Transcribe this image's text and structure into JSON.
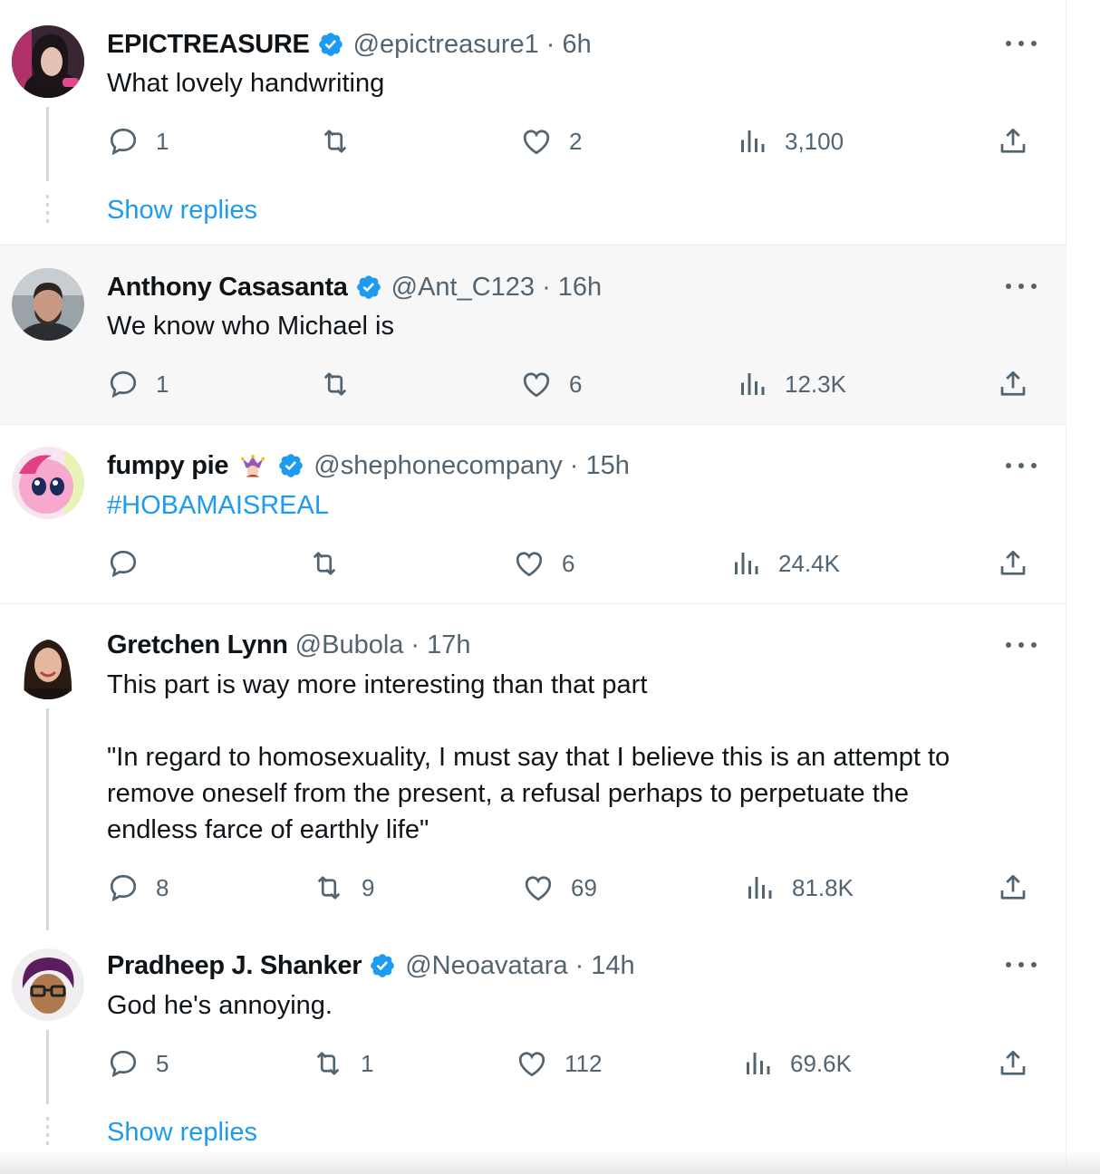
{
  "colors": {
    "accent": "#1d9bf0",
    "muted": "#536471",
    "highlight_bg": "#f7f7f7"
  },
  "tweets": [
    {
      "name": "EPICTREASURE",
      "verified": true,
      "handle": "@epictreasure1",
      "time": "· 6h",
      "text": [
        "What lovely handwriting"
      ],
      "replies": "1",
      "retweets": "",
      "likes": "2",
      "views": "3,100",
      "show_replies": "Show replies",
      "avatar": "avatar-woman-dark-hair"
    },
    {
      "name": "Anthony Casasanta",
      "verified": true,
      "handle": "@Ant_C123",
      "time": "· 16h",
      "text": [
        "We know who Michael is"
      ],
      "replies": "1",
      "retweets": "",
      "likes": "6",
      "views": "12.3K",
      "avatar": "avatar-man-beard"
    },
    {
      "name": "fumpy pie",
      "verified": true,
      "emoji": "jester-emoji",
      "handle": "@shephonecompany",
      "time": "· 15h",
      "text": [
        "#HOBAMAISREAL"
      ],
      "replies": "",
      "retweets": "",
      "likes": "6",
      "views": "24.4K",
      "avatar": "avatar-pink-pony"
    },
    {
      "name": "Gretchen Lynn",
      "verified": false,
      "handle": "@Bubola",
      "time": "· 17h",
      "text": [
        "This part is way more interesting than that part",
        "\"In regard to homosexuality, I must say that I believe this is an attempt to",
        "remove oneself from the present, a refusal perhaps to perpetuate the",
        "endless farce of earthly life\""
      ],
      "replies": "8",
      "retweets": "9",
      "likes": "69",
      "views": "81.8K",
      "avatar": "avatar-woman-smiling"
    },
    {
      "name": "Pradheep J. Shanker",
      "verified": true,
      "handle": "@Neoavatara",
      "time": "· 14h",
      "text": [
        "God he's annoying."
      ],
      "replies": "5",
      "retweets": "1",
      "likes": "112",
      "views": "69.6K",
      "show_replies": "Show replies",
      "avatar": "avatar-cartoon-glasses"
    }
  ]
}
